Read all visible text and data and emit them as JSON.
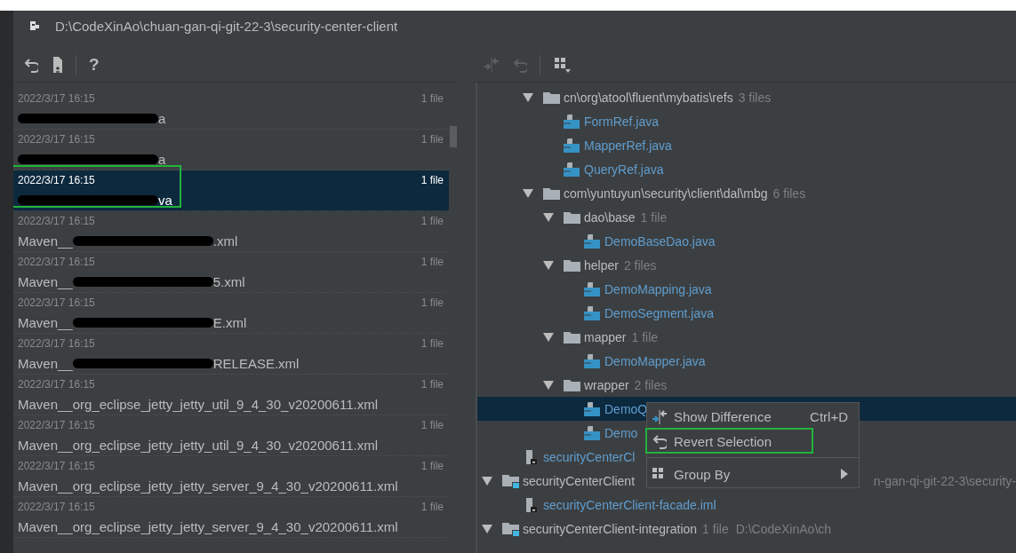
{
  "window": {
    "title": "D:\\CodeXinAo\\chuan-gan-qi-git-22-3\\security-center-client"
  },
  "left_toolbar": {
    "help": "?"
  },
  "commits": [
    {
      "date": "2022/3/17 16:15",
      "count": "1 file",
      "name_end": "a",
      "redacted": true,
      "selected": false,
      "annotated": false
    },
    {
      "date": "2022/3/17 16:15",
      "count": "1 file",
      "name_end": "a",
      "redacted": true,
      "selected": false,
      "annotated": false
    },
    {
      "date": "2022/3/17 16:15",
      "count": "1 file",
      "name_end": "va",
      "redacted": true,
      "selected": true,
      "annotated": true
    },
    {
      "date": "2022/3/17 16:15",
      "count": "1 file",
      "name_start": "Maven__",
      "name_end": ".xml",
      "redacted": true,
      "selected": false,
      "annotated": false
    },
    {
      "date": "2022/3/17 16:15",
      "count": "1 file",
      "name_start": "Maven__",
      "name_end": "5.xml",
      "redacted": true,
      "selected": false,
      "annotated": false
    },
    {
      "date": "2022/3/17 16:15",
      "count": "1 file",
      "name_start": "Maven__",
      "name_end": "E.xml",
      "redacted": true,
      "selected": false,
      "annotated": false
    },
    {
      "date": "2022/3/17 16:15",
      "count": "1 file",
      "name_start": "Maven__",
      "name_end": "RELEASE.xml",
      "redacted": true,
      "selected": false,
      "annotated": false
    },
    {
      "date": "2022/3/17 16:15",
      "count": "1 file",
      "name_start": "Maven__org_eclipse_jetty_jetty_util_9_4_30_v20200611.xml",
      "redacted": false,
      "selected": false,
      "annotated": false
    },
    {
      "date": "2022/3/17 16:15",
      "count": "1 file",
      "name_start": "Maven__org_eclipse_jetty_jetty_util_9_4_30_v20200611.xml",
      "redacted": false,
      "selected": false,
      "annotated": false
    },
    {
      "date": "2022/3/17 16:15",
      "count": "1 file",
      "name_start": "Maven__org_eclipse_jetty_jetty_server_9_4_30_v20200611.xml",
      "redacted": false,
      "selected": false,
      "annotated": false
    },
    {
      "date": "2022/3/17 16:15",
      "count": "1 file",
      "name_start": "Maven__org_eclipse_jetty_jetty_server_9_4_30_v20200611.xml",
      "redacted": false,
      "selected": false,
      "annotated": false
    }
  ],
  "tree": [
    {
      "children": [
        {
          "children": [
            {
              "kind": "folder",
              "name": "cn\\org\\atool\\fluent\\mybatis\\refs",
              "count": "3 files",
              "expanded": true,
              "children": [
                {
                  "kind": "java",
                  "name": "FormRef.java",
                  "selected": false
                },
                {
                  "kind": "java",
                  "name": "MapperRef.java",
                  "selected": false
                },
                {
                  "kind": "java",
                  "name": "QueryRef.java",
                  "selected": false
                }
              ]
            },
            {
              "kind": "folder",
              "name": "com\\yuntuyun\\security\\client\\dal\\mbg",
              "count": "6 files",
              "expanded": true,
              "children": [
                {
                  "kind": "folder",
                  "name": "dao\\base",
                  "count": "1 file",
                  "expanded": true,
                  "children": [
                    {
                      "kind": "java",
                      "name": "DemoBaseDao.java",
                      "selected": false
                    }
                  ]
                },
                {
                  "kind": "folder",
                  "name": "helper",
                  "count": "2 files",
                  "expanded": true,
                  "children": [
                    {
                      "kind": "java",
                      "name": "DemoMapping.java",
                      "selected": false
                    },
                    {
                      "kind": "java",
                      "name": "DemoSegment.java",
                      "selected": false
                    }
                  ]
                },
                {
                  "kind": "folder",
                  "name": "mapper",
                  "count": "1 file",
                  "expanded": true,
                  "children": [
                    {
                      "kind": "java",
                      "name": "DemoMapper.java",
                      "selected": false
                    }
                  ]
                },
                {
                  "kind": "folder",
                  "name": "wrapper",
                  "count": "2 files",
                  "expanded": true,
                  "children": [
                    {
                      "kind": "java",
                      "name": "DemoQ",
                      "selected": true
                    },
                    {
                      "kind": "java",
                      "name": "Demo",
                      "selected": false
                    }
                  ]
                }
              ]
            }
          ]
        },
        {
          "kind": "iml",
          "name": "securityCenterCl",
          "selected": false
        }
      ]
    },
    {
      "kind": "module",
      "name": "securityCenterClient",
      "path_tail": "n-gan-qi-git-22-3\\security-",
      "expanded": true,
      "children": [
        {
          "kind": "iml",
          "name": "securityCenterClient-facade.iml",
          "selected": false
        }
      ]
    },
    {
      "kind": "module",
      "name": "securityCenterClient-integration",
      "count": "1 file",
      "path": "D:\\CodeXinAo\\ch",
      "expanded": true
    }
  ],
  "context_menu": [
    {
      "kind": "compare",
      "label": "Show Difference",
      "shortcut": "Ctrl+D",
      "annotated": false
    },
    {
      "kind": "revert",
      "label": "Revert Selection",
      "annotated": true
    },
    {
      "kind": "separator"
    },
    {
      "kind": "group",
      "label": "Group By",
      "submenu": true,
      "annotated": false
    }
  ]
}
